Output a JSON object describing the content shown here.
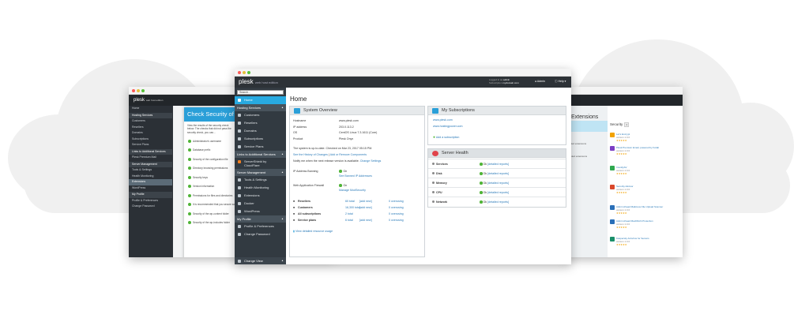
{
  "back_left": {
    "logo": "plesk",
    "logo_sub": "web host edition",
    "sidebar": [
      "Home",
      "Hosting Services",
      "Customers",
      "Resellers",
      "Domains",
      "Subscriptions",
      "Service Plans",
      "Links to Additional Services",
      "Plesk Premium Mail",
      "Server Management",
      "Tools & Settings",
      "Health Monitoring",
      "Extensions",
      "WordPress",
      "My Profile",
      "Profile & Preferences",
      "Change Password"
    ],
    "sidebar_headers": [
      1,
      7,
      9,
      14
    ],
    "sidebar_active": 12,
    "modal": {
      "title": "Check Security of WordPress",
      "text": "View the results of the security check below. The checks that did not pass the security check, you can...",
      "checks": [
        "Administrator's username",
        "Database prefix",
        "Security of the configuration file",
        "Directory browsing permissions",
        "Security keys",
        "Version information",
        "Permissions for files and directories",
        "It is recommended that you secure some of your plugins might stop working",
        "Security of the wp-content folder",
        "Security of the wp-includes folder"
      ]
    }
  },
  "back_right": {
    "title": "Extensions",
    "left_text": [
      "led extensions",
      "ded extensions"
    ],
    "security_label": "Security",
    "security_badge": "1",
    "extensions": [
      {
        "name": "Let's Encrypt",
        "sub": "version 1.0.0",
        "color": "#f2a200"
      },
      {
        "name": "Plesk Premium Email, powered by Kolab",
        "sub": "version 1.0.0",
        "color": "#7b3ec4"
      },
      {
        "name": "ImunifyAV",
        "sub": "version 1.0.0",
        "color": "#2fa84f"
      },
      {
        "name": "Security Advisor",
        "sub": "version 1.0.0",
        "color": "#d9482b"
      },
      {
        "name": "Admin Ahead Malicious File Upload Scanner",
        "sub": "version 1.0.0",
        "color": "#2a6fb8"
      },
      {
        "name": "Admin Ahead MaxDDoS Protection",
        "sub": "version 1.0.0",
        "color": "#2a6fb8"
      },
      {
        "name": "Kaspersky Antivirus for Servers",
        "sub": "version 1.0.0",
        "color": "#1a8f6a"
      }
    ]
  },
  "main": {
    "logo": "plesk",
    "logo_sub": "web host edition",
    "logged_in_label": "Logged in as",
    "logged_in_user": "admin",
    "subscription_label": "Subscription",
    "subscription_domain": "mydomain.com",
    "user_menu": "Admin",
    "help_menu": "Help",
    "search_placeholder": "Search...",
    "sidebar": {
      "home": "Home",
      "hosting_services": "Hosting Services",
      "customers": "Customers",
      "resellers": "Resellers",
      "domains": "Domains",
      "subscriptions": "Subscriptions",
      "service_plans": "Service Plans",
      "links_additional": "Links to Additional Services",
      "servershield": "ServerShield by CloudFlare",
      "server_management": "Server Management",
      "tools_settings": "Tools & Settings",
      "health_monitoring": "Health Monitoring",
      "extensions": "Extensions",
      "docker": "Docker",
      "wordpress": "WordPress",
      "my_profile": "My Profile",
      "profile_prefs": "Profile & Preferences",
      "change_password": "Change Password",
      "change_view": "Change View"
    },
    "page_title": "Home",
    "system_overview": {
      "title": "System Overview",
      "rows": [
        {
          "label": "Hostname",
          "value": "www.plesk.com"
        },
        {
          "label": "IP address",
          "value": "203.0.113.2"
        },
        {
          "label": "OS",
          "value": "CentOS Linux 7.3.1611 (Core)"
        },
        {
          "label": "Product",
          "value": "Plesk Onyx"
        }
      ],
      "uptodate": "The system is up-to-date. Checked on Mar 23, 2017 05:15 PM.",
      "history_link": "See the History of Changes",
      "add_remove_link": "Add or Remove Components",
      "notify_text": "Notify me when the next release version is available.",
      "change_settings": "Change Settings",
      "ip_banning_label": "IP Address Banning",
      "ip_banning_status": "On",
      "ip_banning_link": "See Banned IP Addresses",
      "waf_label": "Web Application Firewall",
      "waf_status": "On",
      "waf_link": "Manage ModSecurity",
      "stats": [
        {
          "label": "Resellers",
          "value": "60 total",
          "add": "[add new]",
          "over": "0 overusing"
        },
        {
          "label": "Customers",
          "value": "16,300 total",
          "add": "[add new]",
          "over": "0 overusing"
        },
        {
          "label": "All subscriptions",
          "value": "2 total",
          "add": "",
          "over": "0 overusing"
        },
        {
          "label": "Service plans",
          "value": "6 total",
          "add": "[add new]",
          "over": "0 overusing"
        }
      ],
      "resource_link": "View detailed resource usage"
    },
    "subscriptions": {
      "title": "My Subscriptions",
      "links": [
        "www.plesk.com",
        "www.hostingpower.com"
      ],
      "add_link": "Add a subscription"
    },
    "health": {
      "title": "Server Health",
      "rows": [
        {
          "name": "Services",
          "status": "Ok",
          "link": "[detailed reports]"
        },
        {
          "name": "Disk",
          "status": "Ok",
          "link": "[detailed reports]"
        },
        {
          "name": "Memory",
          "status": "Ok",
          "link": "[detailed reports]"
        },
        {
          "name": "CPU",
          "status": "Ok",
          "link": "[detailed reports]"
        },
        {
          "name": "Network",
          "status": "Ok",
          "link": "[detailed reports]"
        }
      ]
    }
  }
}
